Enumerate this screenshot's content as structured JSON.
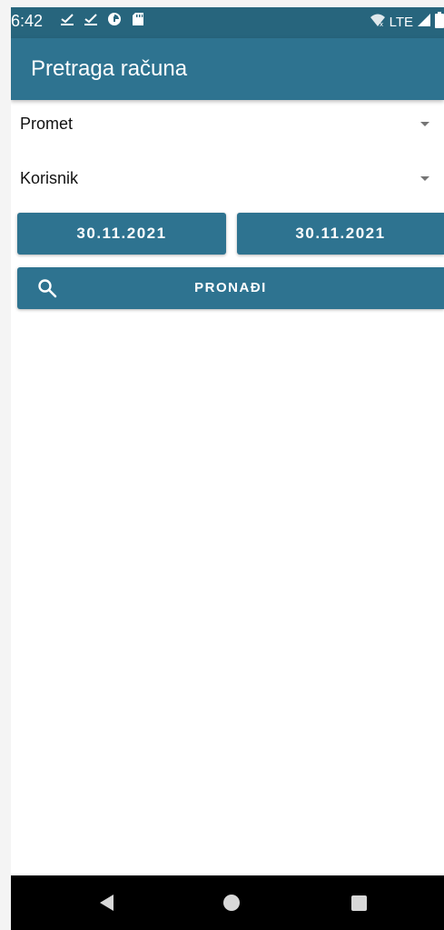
{
  "status_bar": {
    "time": "6:42",
    "network_label": "LTE",
    "left_icons": [
      "download-done-icon",
      "download-done-icon",
      "data-saver-icon",
      "sd-card-icon"
    ],
    "right_icons": [
      "wifi-off-icon",
      "signal-icon",
      "battery-icon"
    ]
  },
  "app_bar": {
    "title": "Pretraga računa"
  },
  "filters": {
    "turnover_dropdown": "Promet",
    "user_dropdown": "Korisnik"
  },
  "dates": {
    "from": "30.11.2021",
    "to": "30.11.2021"
  },
  "search_button": {
    "label": "PRONAĐI",
    "icon": "search-icon"
  },
  "nav_bar": {
    "icons": [
      "back-icon",
      "home-icon",
      "recent-apps-icon"
    ]
  },
  "colors": {
    "primary": "#2e7390",
    "status_bar": "#27657d",
    "nav_bar": "#000000"
  }
}
